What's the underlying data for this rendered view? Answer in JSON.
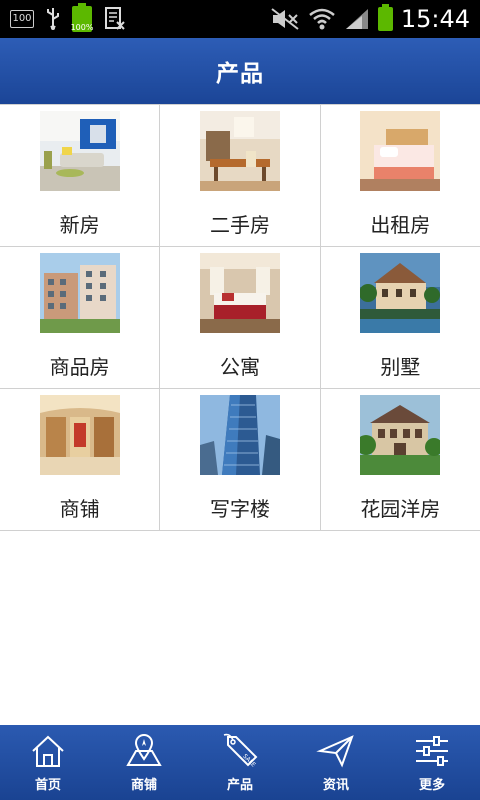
{
  "status_bar": {
    "left_badge": "100",
    "battery_small_label": "100%",
    "time": "15:44"
  },
  "header": {
    "title": "产品"
  },
  "grid": {
    "items": [
      {
        "label": "新房",
        "icon": "new-house-photo"
      },
      {
        "label": "二手房",
        "icon": "second-hand-house-photo"
      },
      {
        "label": "出租房",
        "icon": "rental-house-photo"
      },
      {
        "label": "商品房",
        "icon": "commercial-housing-photo"
      },
      {
        "label": "公寓",
        "icon": "apartment-photo"
      },
      {
        "label": "别墅",
        "icon": "villa-photo"
      },
      {
        "label": "商铺",
        "icon": "shop-photo"
      },
      {
        "label": "写字楼",
        "icon": "office-building-photo"
      },
      {
        "label": "花园洋房",
        "icon": "garden-house-photo"
      }
    ]
  },
  "bottom_nav": {
    "items": [
      {
        "label": "首页",
        "icon": "home-icon"
      },
      {
        "label": "商铺",
        "icon": "map-icon"
      },
      {
        "label": "产品",
        "icon": "sale-tag-icon"
      },
      {
        "label": "资讯",
        "icon": "paper-plane-icon"
      },
      {
        "label": "更多",
        "icon": "sliders-icon"
      }
    ]
  },
  "colors": {
    "header_blue": "#2d5db6",
    "nav_blue": "#1a4392",
    "battery_green": "#5cb800",
    "grid_line": "#d0d0d0"
  }
}
